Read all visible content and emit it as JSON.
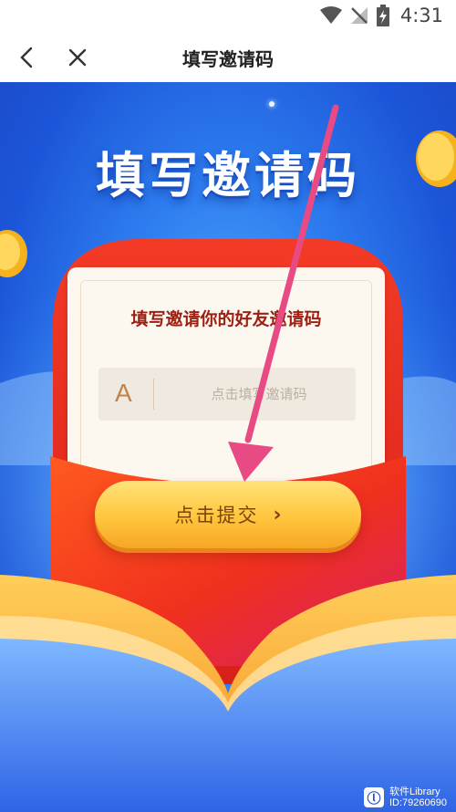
{
  "status_bar": {
    "time": "4:31",
    "icons": [
      "wifi-icon",
      "no-signal-icon",
      "battery-charging-icon"
    ]
  },
  "nav": {
    "title": "填写邀请码",
    "back_icon": "chevron-left-icon",
    "close_icon": "close-icon"
  },
  "hero": {
    "title": "填写邀请码"
  },
  "card": {
    "heading": "填写邀请你的好友邀请码",
    "input_letter": "A",
    "input_placeholder": "点击填写邀请码"
  },
  "submit": {
    "label": "点击提交",
    "chevron": "›"
  },
  "watermark": {
    "line1": "软件Library",
    "line2": "ID:79260690"
  },
  "colors": {
    "hero_blue": "#2e7ef0",
    "envelope_red": "#e8321f",
    "button_gold": "#ffc53d",
    "heading_red": "#9c1f14",
    "arrow_pink": "#e84b84"
  }
}
